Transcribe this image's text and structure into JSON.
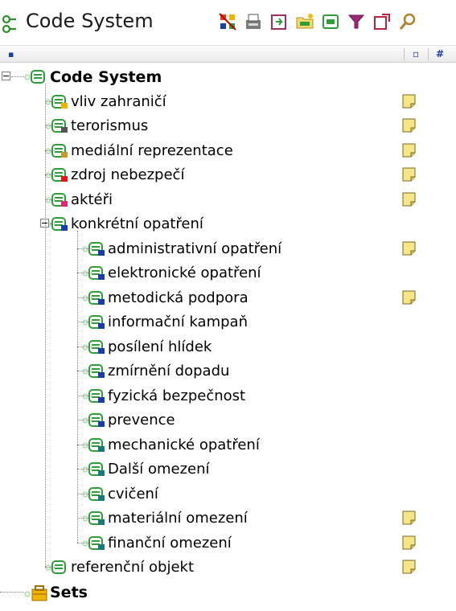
{
  "window": {
    "title": "Code System"
  },
  "toolbar": {
    "buttons": [
      "new-code-icon",
      "import-icon",
      "export-icon",
      "folder-new-icon",
      "folder-icon",
      "filter-icon",
      "reset-icon",
      "search-icon"
    ]
  },
  "colors": {
    "memo_fill": "#f7e58a",
    "code_icon": "#2f9e3a",
    "connector": "#808080"
  },
  "tree": {
    "root": {
      "label": "Code System"
    },
    "codes": [
      {
        "label": "vliv zahraničí",
        "color": "#f0b400",
        "memo": true
      },
      {
        "label": "terorismus",
        "color": "#555555",
        "memo": true
      },
      {
        "label": "mediální reprezentace",
        "color": "#c89a2a",
        "memo": true
      },
      {
        "label": "zdroj nebezpečí",
        "color": "#e01818",
        "memo": true
      },
      {
        "label": "aktéři",
        "color": "#e0287a",
        "memo": true
      },
      {
        "label": "konkrétní opatření",
        "color": "#1a3ea8",
        "memo": false,
        "children": [
          {
            "label": "administrativní opatření",
            "color": "#1a3ea8",
            "memo": true
          },
          {
            "label": "elektronické opatření",
            "color": "#1a3ea8",
            "memo": false
          },
          {
            "label": "metodická podpora",
            "color": "#1a3ea8",
            "memo": true
          },
          {
            "label": "informační kampaň",
            "color": "#1a3ea8",
            "memo": false
          },
          {
            "label": "posílení hlídek",
            "color": "#1a3ea8",
            "memo": false
          },
          {
            "label": "zmírnění dopadu",
            "color": "#1a3ea8",
            "memo": false
          },
          {
            "label": "fyzická bezpečnost",
            "color": "#1a3ea8",
            "memo": false
          },
          {
            "label": "prevence",
            "color": "#1a3ea8",
            "memo": false
          },
          {
            "label": "mechanické opatření",
            "color": "#1a7a7a",
            "memo": false
          },
          {
            "label": "Další omezení",
            "color": "#1a7a7a",
            "memo": false
          },
          {
            "label": "cvičení",
            "color": "#1a7a7a",
            "memo": false
          },
          {
            "label": "materiální omezení",
            "color": "#1a7a7a",
            "memo": true
          },
          {
            "label": "finanční omezení",
            "color": "#1a7a7a",
            "memo": true
          }
        ]
      },
      {
        "label": "referenční objekt",
        "color": "",
        "memo": true
      }
    ],
    "sets": {
      "label": "Sets"
    }
  }
}
